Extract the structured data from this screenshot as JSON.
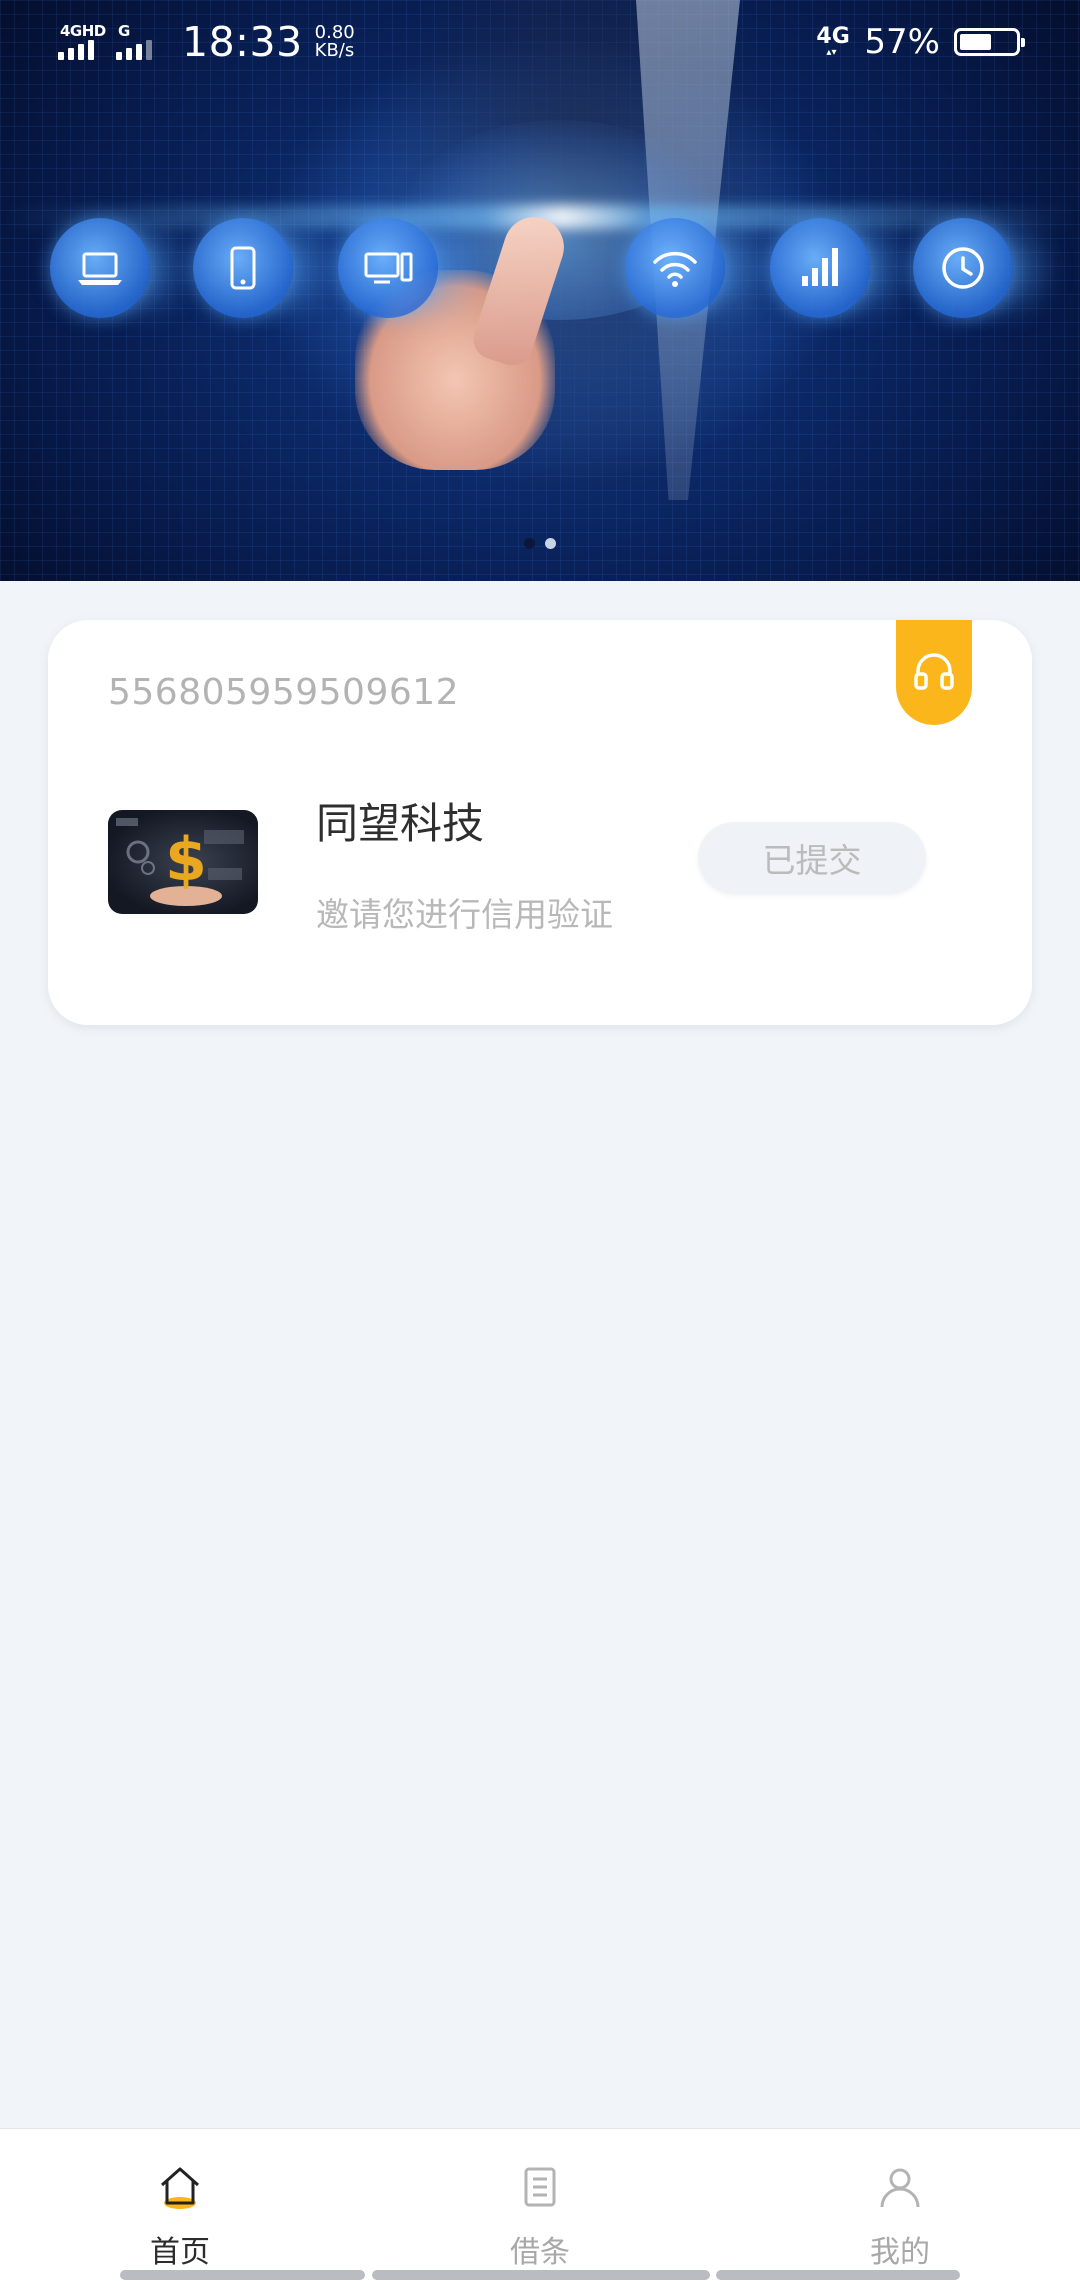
{
  "status_bar": {
    "network_left_1": "4GHD",
    "network_left_2": "G",
    "time": "18:33",
    "speed_value": "0.80",
    "speed_unit": "KB/s",
    "network_right": "4G",
    "battery_percent": "57%",
    "battery_level": 0.57
  },
  "banner": {
    "active_slide": 2,
    "slide_count": 2,
    "icons": [
      "laptop-icon",
      "phone-icon",
      "desktop-icon",
      "wifi-icon",
      "signal-icon",
      "clock-icon"
    ]
  },
  "card": {
    "id_number": "556805959509612",
    "company_name": "同望科技",
    "invite_text": "邀请您进行信用验证",
    "status_button": "已提交",
    "service_icon": "headset-icon",
    "accent_color": "#fbb61c"
  },
  "bottom_nav": {
    "items": [
      {
        "label": "首页",
        "icon": "home-icon",
        "active": true
      },
      {
        "label": "借条",
        "icon": "document-icon",
        "active": false
      },
      {
        "label": "我的",
        "icon": "profile-icon",
        "active": false
      }
    ]
  }
}
